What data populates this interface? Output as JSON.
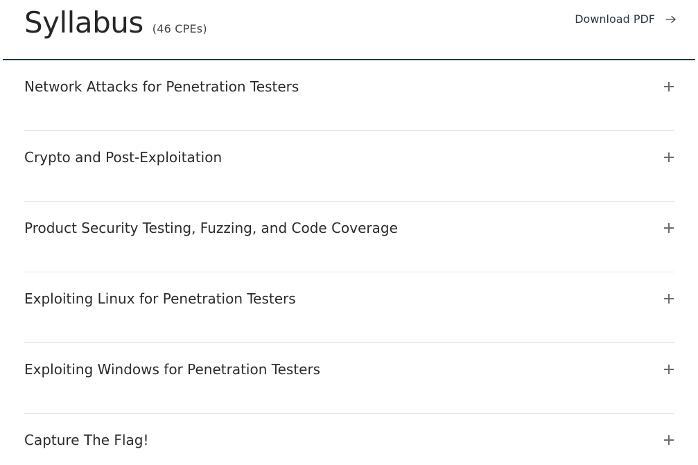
{
  "header": {
    "title": "Syllabus",
    "cpes": "(46 CPEs)",
    "download_label": "Download PDF",
    "download_icon": "arrow-right-icon",
    "rule_color": "#1e3a4a"
  },
  "syllabus": {
    "expand_icon": "plus-icon",
    "items": [
      {
        "label": "Network Attacks for Penetration Testers"
      },
      {
        "label": "Crypto and Post-Exploitation"
      },
      {
        "label": "Product Security Testing, Fuzzing, and Code Coverage"
      },
      {
        "label": "Exploiting Linux for Penetration Testers"
      },
      {
        "label": "Exploiting Windows for Penetration Testers"
      },
      {
        "label": "Capture The Flag!"
      }
    ]
  }
}
